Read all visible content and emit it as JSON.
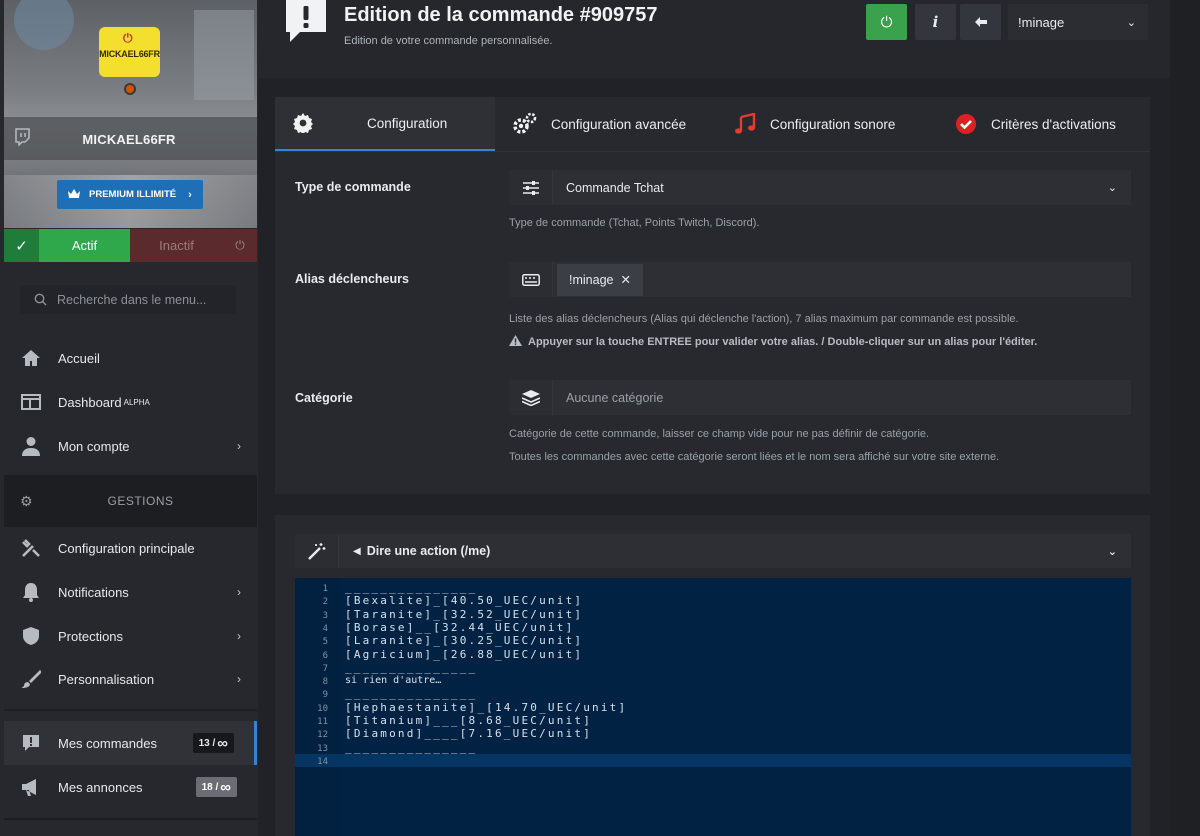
{
  "sidebar": {
    "username": "MICKAEL66FR",
    "avatar_text": "MICKAEL66FR",
    "premium_label": "PREMIUM ILLIMITÉ",
    "toggle": {
      "active": "Actif",
      "inactive": "Inactif"
    },
    "search_placeholder": "Recherche dans le menu...",
    "menu": {
      "accueil": "Accueil",
      "dashboard": "Dashboard",
      "dashboard_badge": "ALPHA",
      "compte": "Mon compte"
    },
    "section_title": "GESTIONS",
    "gestions": {
      "config": "Configuration principale",
      "notifications": "Notifications",
      "protections": "Protections",
      "personnalisation": "Personnalisation"
    },
    "commandes": {
      "label": "Mes commandes",
      "count": "13 /"
    },
    "annonces": {
      "label": "Mes annonces",
      "count": "18 /"
    },
    "infinity": "∞"
  },
  "header": {
    "title": "Edition de la commande #909757",
    "subtitle": "Edition de votre commande personnalisée.",
    "info_label": "i",
    "select_value": "!minage"
  },
  "tabs": [
    {
      "label": "Configuration"
    },
    {
      "label": "Configuration avancée"
    },
    {
      "label": "Configuration sonore"
    },
    {
      "label": "Critères d'activations"
    }
  ],
  "form": {
    "type": {
      "label": "Type de commande",
      "value": "Commande Tchat",
      "help": "Type de commande (Tchat, Points Twitch, Discord)."
    },
    "alias": {
      "label": "Alias déclencheurs",
      "tag": "!minage",
      "help": "Liste des alias déclencheurs (Alias qui déclenche l'action), 7 alias maximum par commande est possible.",
      "warning": "Appuyer sur la touche ENTREE pour valider votre alias. / Double-cliquer sur un alias pour l'éditer."
    },
    "categorie": {
      "label": "Catégorie",
      "placeholder": "Aucune catégorie",
      "help1": "Catégorie de cette commande, laisser ce champ vide pour ne pas définir de catégorie.",
      "help2": "Toutes les commandes avec cette catégorie seront liées et le nom sera affiché sur votre site externe."
    }
  },
  "action": {
    "label": "Dire une action (/me)"
  },
  "editor": {
    "lines": [
      {
        "n": "1",
        "text": "_______________"
      },
      {
        "n": "2",
        "text": "[Bexalite]_[40.50_UEC/unit]"
      },
      {
        "n": "3",
        "text": "[Taranite]_[32.52_UEC/unit]"
      },
      {
        "n": "4",
        "text": "[Borase]__[32.44_UEC/unit]"
      },
      {
        "n": "5",
        "text": "[Laranite]_[30.25_UEC/unit]"
      },
      {
        "n": "6",
        "text": "[Agricium]_[26.88_UEC/unit]"
      },
      {
        "n": "7",
        "text": "_______________"
      },
      {
        "n": "8",
        "text": "si rien d'autre…"
      },
      {
        "n": "9",
        "text": "_______________"
      },
      {
        "n": "10",
        "text": "[Hephaestanite]_[14.70_UEC/unit]"
      },
      {
        "n": "11",
        "text": "[Titanium]___[8.68_UEC/unit]"
      },
      {
        "n": "12",
        "text": "[Diamond]____[7.16_UEC/unit]"
      },
      {
        "n": "13",
        "text": "_______________"
      },
      {
        "n": "14",
        "text": ""
      }
    ]
  }
}
